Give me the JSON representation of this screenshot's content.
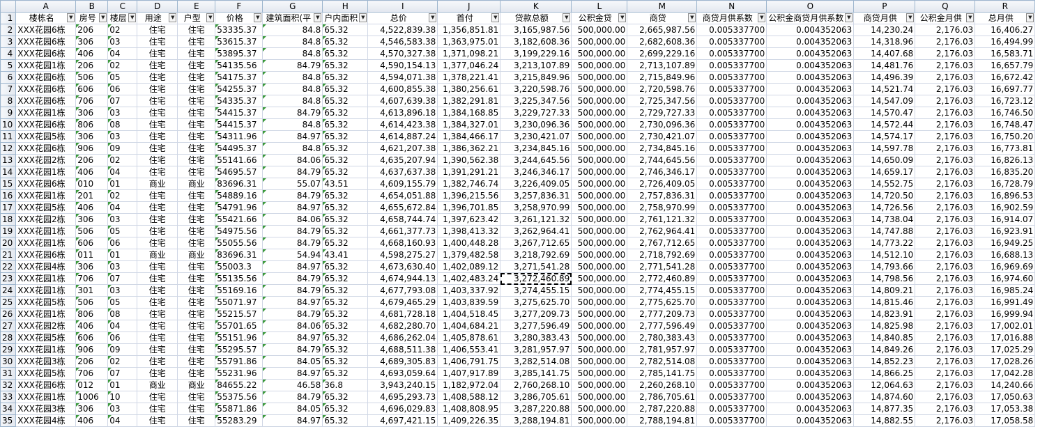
{
  "columns": [
    "A",
    "B",
    "C",
    "D",
    "E",
    "F",
    "G",
    "H",
    "I",
    "J",
    "K",
    "L",
    "M",
    "N",
    "O",
    "P",
    "Q",
    "R"
  ],
  "headers": [
    "楼栋名",
    "房号",
    "楼层",
    "用途",
    "户型",
    "价格",
    "建筑面积(平",
    "户内面积",
    "总价",
    "首付",
    "贷款总额",
    "公积金贷",
    "商贷",
    "商贷月供系数",
    "公积金商贷月供系数",
    "商贷月供",
    "公积金月供",
    "总月供"
  ],
  "header_row_number": "1",
  "rows": [
    {
      "r": "2",
      "c": [
        "XXX花园6栋",
        "206",
        "02",
        "住宅",
        "住宅",
        "53335.37",
        "84.8",
        "65.32",
        "4,522,839.38",
        "1,356,851.81",
        "3,165,987.56",
        "500,000.00",
        "2,665,987.56",
        "0.005337700",
        "0.004352063",
        "14,230.24",
        "2,176.03",
        "16,406.27"
      ]
    },
    {
      "r": "3",
      "c": [
        "XXX花园6栋",
        "306",
        "03",
        "住宅",
        "住宅",
        "53615.37",
        "84.8",
        "65.32",
        "4,546,583.38",
        "1,363,975.01",
        "3,182,608.36",
        "500,000.00",
        "2,682,608.36",
        "0.005337700",
        "0.004352063",
        "14,318.96",
        "2,176.03",
        "16,494.99"
      ]
    },
    {
      "r": "4",
      "c": [
        "XXX花园6栋",
        "406",
        "04",
        "住宅",
        "住宅",
        "53895.37",
        "84.8",
        "65.32",
        "4,570,327.38",
        "1,371,098.21",
        "3,199,229.16",
        "500,000.00",
        "2,699,229.16",
        "0.005337700",
        "0.004352063",
        "14,407.68",
        "2,176.03",
        "16,583.71"
      ]
    },
    {
      "r": "5",
      "c": [
        "XXX花园1栋",
        "206",
        "02",
        "住宅",
        "住宅",
        "54135.56",
        "84.79",
        "65.32",
        "4,590,154.13",
        "1,377,046.24",
        "3,213,107.89",
        "500,000.00",
        "2,713,107.89",
        "0.005337700",
        "0.004352063",
        "14,481.76",
        "2,176.03",
        "16,657.79"
      ]
    },
    {
      "r": "6",
      "c": [
        "XXX花园6栋",
        "506",
        "05",
        "住宅",
        "住宅",
        "54175.37",
        "84.8",
        "65.32",
        "4,594,071.38",
        "1,378,221.41",
        "3,215,849.96",
        "500,000.00",
        "2,715,849.96",
        "0.005337700",
        "0.004352063",
        "14,496.39",
        "2,176.03",
        "16,672.42"
      ]
    },
    {
      "r": "7",
      "c": [
        "XXX花园6栋",
        "606",
        "06",
        "住宅",
        "住宅",
        "54255.37",
        "84.8",
        "65.32",
        "4,600,855.38",
        "1,380,256.61",
        "3,220,598.76",
        "500,000.00",
        "2,720,598.76",
        "0.005337700",
        "0.004352063",
        "14,521.74",
        "2,176.03",
        "16,697.77"
      ]
    },
    {
      "r": "8",
      "c": [
        "XXX花园6栋",
        "706",
        "07",
        "住宅",
        "住宅",
        "54335.37",
        "84.8",
        "65.32",
        "4,607,639.38",
        "1,382,291.81",
        "3,225,347.56",
        "500,000.00",
        "2,725,347.56",
        "0.005337700",
        "0.004352063",
        "14,547.09",
        "2,176.03",
        "16,723.12"
      ]
    },
    {
      "r": "9",
      "c": [
        "XXX花园1栋",
        "306",
        "03",
        "住宅",
        "住宅",
        "54415.37",
        "84.79",
        "65.32",
        "4,613,896.18",
        "1,384,168.85",
        "3,229,727.33",
        "500,000.00",
        "2,729,727.33",
        "0.005337700",
        "0.004352063",
        "14,570.47",
        "2,176.03",
        "16,746.50"
      ]
    },
    {
      "r": "10",
      "c": [
        "XXX花园6栋",
        "806",
        "08",
        "住宅",
        "住宅",
        "54415.37",
        "84.8",
        "65.32",
        "4,614,423.38",
        "1,384,327.01",
        "3,230,096.36",
        "500,000.00",
        "2,730,096.36",
        "0.005337700",
        "0.004352063",
        "14,572.44",
        "2,176.03",
        "16,748.47"
      ]
    },
    {
      "r": "11",
      "c": [
        "XXX花园5栋",
        "306",
        "03",
        "住宅",
        "住宅",
        "54311.96",
        "84.97",
        "65.32",
        "4,614,887.24",
        "1,384,466.17",
        "3,230,421.07",
        "500,000.00",
        "2,730,421.07",
        "0.005337700",
        "0.004352063",
        "14,574.17",
        "2,176.03",
        "16,750.20"
      ]
    },
    {
      "r": "12",
      "c": [
        "XXX花园6栋",
        "906",
        "09",
        "住宅",
        "住宅",
        "54495.37",
        "84.8",
        "65.32",
        "4,621,207.38",
        "1,386,362.21",
        "3,234,845.16",
        "500,000.00",
        "2,734,845.16",
        "0.005337700",
        "0.004352063",
        "14,597.78",
        "2,176.03",
        "16,773.81"
      ]
    },
    {
      "r": "13",
      "c": [
        "XXX花园2栋",
        "206",
        "02",
        "住宅",
        "住宅",
        "55141.66",
        "84.06",
        "65.32",
        "4,635,207.94",
        "1,390,562.38",
        "3,244,645.56",
        "500,000.00",
        "2,744,645.56",
        "0.005337700",
        "0.004352063",
        "14,650.09",
        "2,176.03",
        "16,826.13"
      ]
    },
    {
      "r": "14",
      "c": [
        "XXX花园1栋",
        "406",
        "04",
        "住宅",
        "住宅",
        "54695.57",
        "84.79",
        "65.32",
        "4,637,637.38",
        "1,391,291.21",
        "3,246,346.17",
        "500,000.00",
        "2,746,346.17",
        "0.005337700",
        "0.004352063",
        "14,659.17",
        "2,176.03",
        "16,835.20"
      ]
    },
    {
      "r": "15",
      "c": [
        "XXX花园6栋",
        "010",
        "01",
        "商业",
        "商业",
        "83696.31",
        "55.07",
        "43.51",
        "4,609,155.79",
        "1,382,746.74",
        "3,226,409.05",
        "500,000.00",
        "2,726,409.05",
        "0.005337700",
        "0.004352063",
        "14,552.75",
        "2,176.03",
        "16,728.79"
      ]
    },
    {
      "r": "16",
      "c": [
        "XXX花园1栋",
        "201",
        "02",
        "住宅",
        "住宅",
        "54889.16",
        "84.79",
        "65.32",
        "4,654,051.88",
        "1,396,215.56",
        "3,257,836.31",
        "500,000.00",
        "2,757,836.31",
        "0.005337700",
        "0.004352063",
        "14,720.50",
        "2,176.03",
        "16,896.53"
      ]
    },
    {
      "r": "17",
      "c": [
        "XXX花园5栋",
        "406",
        "04",
        "住宅",
        "住宅",
        "54791.96",
        "84.97",
        "65.32",
        "4,655,672.84",
        "1,396,701.85",
        "3,258,970.99",
        "500,000.00",
        "2,758,970.99",
        "0.005337700",
        "0.004352063",
        "14,726.56",
        "2,176.03",
        "16,902.59"
      ]
    },
    {
      "r": "18",
      "c": [
        "XXX花园2栋",
        "306",
        "03",
        "住宅",
        "住宅",
        "55421.66",
        "84.06",
        "65.32",
        "4,658,744.74",
        "1,397,623.42",
        "3,261,121.32",
        "500,000.00",
        "2,761,121.32",
        "0.005337700",
        "0.004352063",
        "14,738.04",
        "2,176.03",
        "16,914.07"
      ]
    },
    {
      "r": "19",
      "c": [
        "XXX花园1栋",
        "506",
        "05",
        "住宅",
        "住宅",
        "54975.56",
        "84.79",
        "65.32",
        "4,661,377.73",
        "1,398,413.32",
        "3,262,964.41",
        "500,000.00",
        "2,762,964.41",
        "0.005337700",
        "0.004352063",
        "14,747.88",
        "2,176.03",
        "16,923.91"
      ]
    },
    {
      "r": "20",
      "c": [
        "XXX花园1栋",
        "606",
        "06",
        "住宅",
        "住宅",
        "55055.56",
        "84.79",
        "65.32",
        "4,668,160.93",
        "1,400,448.28",
        "3,267,712.65",
        "500,000.00",
        "2,767,712.65",
        "0.005337700",
        "0.004352063",
        "14,773.22",
        "2,176.03",
        "16,949.25"
      ]
    },
    {
      "r": "21",
      "c": [
        "XXX花园6栋",
        "011",
        "01",
        "商业",
        "商业",
        "83696.31",
        "54.94",
        "43.41",
        "4,598,275.27",
        "1,379,482.58",
        "3,218,792.69",
        "500,000.00",
        "2,718,792.69",
        "0.005337700",
        "0.004352063",
        "14,512.10",
        "2,176.03",
        "16,688.13"
      ]
    },
    {
      "r": "22",
      "c": [
        "XXX花园4栋",
        "306",
        "03",
        "住宅",
        "住宅",
        "55003.3",
        "84.97",
        "65.32",
        "4,673,630.40",
        "1,402,089.12",
        "3,271,541.28",
        "500,000.00",
        "2,771,541.28",
        "0.005337700",
        "0.004352063",
        "14,793.66",
        "2,176.03",
        "16,969.69"
      ]
    },
    {
      "r": "23",
      "c": [
        "XXX花园1栋",
        "706",
        "07",
        "住宅",
        "住宅",
        "55135.56",
        "84.79",
        "65.32",
        "4,674,944.13",
        "1,402,483.24",
        "3,272,460.89",
        "500,000.00",
        "2,772,460.89",
        "0.005337700",
        "0.004352063",
        "14,798.56",
        "2,176.03",
        "16,974.60"
      ]
    },
    {
      "r": "24",
      "c": [
        "XXX花园1栋",
        "301",
        "03",
        "住宅",
        "住宅",
        "55169.16",
        "84.79",
        "65.32",
        "4,677,793.08",
        "1,403,337.92",
        "3,274,455.15",
        "500,000.00",
        "2,774,455.15",
        "0.005337700",
        "0.004352063",
        "14,809.21",
        "2,176.03",
        "16,985.24"
      ]
    },
    {
      "r": "25",
      "c": [
        "XXX花园5栋",
        "506",
        "05",
        "住宅",
        "住宅",
        "55071.97",
        "84.97",
        "65.32",
        "4,679,465.29",
        "1,403,839.59",
        "3,275,625.70",
        "500,000.00",
        "2,775,625.70",
        "0.005337700",
        "0.004352063",
        "14,815.46",
        "2,176.03",
        "16,991.49"
      ]
    },
    {
      "r": "26",
      "c": [
        "XXX花园1栋",
        "806",
        "08",
        "住宅",
        "住宅",
        "55215.57",
        "84.79",
        "65.32",
        "4,681,728.18",
        "1,404,518.45",
        "3,277,209.73",
        "500,000.00",
        "2,777,209.73",
        "0.005337700",
        "0.004352063",
        "14,823.91",
        "2,176.03",
        "16,999.94"
      ]
    },
    {
      "r": "27",
      "c": [
        "XXX花园2栋",
        "406",
        "04",
        "住宅",
        "住宅",
        "55701.65",
        "84.06",
        "65.32",
        "4,682,280.70",
        "1,404,684.21",
        "3,277,596.49",
        "500,000.00",
        "2,777,596.49",
        "0.005337700",
        "0.004352063",
        "14,825.98",
        "2,176.03",
        "17,002.01"
      ]
    },
    {
      "r": "28",
      "c": [
        "XXX花园5栋",
        "606",
        "06",
        "住宅",
        "住宅",
        "55151.96",
        "84.97",
        "65.32",
        "4,686,262.04",
        "1,405,878.61",
        "3,280,383.43",
        "500,000.00",
        "2,780,383.43",
        "0.005337700",
        "0.004352063",
        "14,840.85",
        "2,176.03",
        "17,016.88"
      ]
    },
    {
      "r": "29",
      "c": [
        "XXX花园1栋",
        "906",
        "09",
        "住宅",
        "住宅",
        "55295.57",
        "84.79",
        "65.32",
        "4,688,511.38",
        "1,406,553.41",
        "3,281,957.97",
        "500,000.00",
        "2,781,957.97",
        "0.005337700",
        "0.004352063",
        "14,849.26",
        "2,176.03",
        "17,025.29"
      ]
    },
    {
      "r": "30",
      "c": [
        "XXX花园3栋",
        "206",
        "02",
        "住宅",
        "住宅",
        "55791.86",
        "84.05",
        "65.32",
        "4,689,305.83",
        "1,406,791.75",
        "3,282,514.08",
        "500,000.00",
        "2,782,514.08",
        "0.005337700",
        "0.004352063",
        "14,852.23",
        "2,176.03",
        "17,028.26"
      ]
    },
    {
      "r": "31",
      "c": [
        "XXX花园5栋",
        "706",
        "07",
        "住宅",
        "住宅",
        "55231.96",
        "84.97",
        "65.32",
        "4,693,059.64",
        "1,407,917.89",
        "3,285,141.75",
        "500,000.00",
        "2,785,141.75",
        "0.005337700",
        "0.004352063",
        "14,866.25",
        "2,176.03",
        "17,042.28"
      ]
    },
    {
      "r": "32",
      "c": [
        "XXX花园6栋",
        "012",
        "01",
        "商业",
        "商业",
        "84655.22",
        "46.58",
        "36.8",
        "3,943,240.15",
        "1,182,972.04",
        "2,760,268.10",
        "500,000.00",
        "2,260,268.10",
        "0.005337700",
        "0.004352063",
        "12,064.63",
        "2,176.03",
        "14,240.66"
      ]
    },
    {
      "r": "33",
      "c": [
        "XXX花园1栋",
        "1006",
        "10",
        "住宅",
        "住宅",
        "55375.56",
        "84.79",
        "65.32",
        "4,695,293.73",
        "1,408,588.12",
        "3,286,705.61",
        "500,000.00",
        "2,786,705.61",
        "0.005337700",
        "0.004352063",
        "14,874.60",
        "2,176.03",
        "17,050.63"
      ]
    },
    {
      "r": "34",
      "c": [
        "XXX花园3栋",
        "306",
        "03",
        "住宅",
        "住宅",
        "55871.86",
        "84.05",
        "65.32",
        "4,696,029.83",
        "1,408,808.95",
        "3,287,220.88",
        "500,000.00",
        "2,787,220.88",
        "0.005337700",
        "0.004352063",
        "14,877.35",
        "2,176.03",
        "17,053.38"
      ]
    },
    {
      "r": "35",
      "c": [
        "XXX花园4栋",
        "406",
        "04",
        "住宅",
        "住宅",
        "55283.29",
        "84.97",
        "65.32",
        "4,697,421.15",
        "1,409,226.35",
        "3,288,194.81",
        "500,000.00",
        "2,788,194.81",
        "0.005337700",
        "0.004352063",
        "14,882.55",
        "2,176.03",
        "17,058.58"
      ]
    }
  ]
}
